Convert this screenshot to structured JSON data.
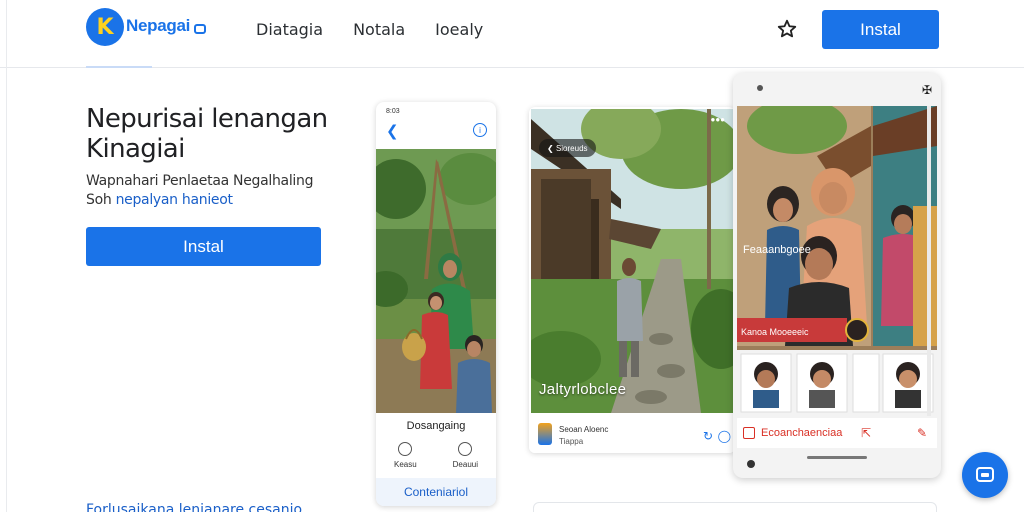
{
  "header": {
    "logo_letter": "K",
    "logo_name": "Nepagai",
    "nav": [
      "Diatagia",
      "Notala",
      "Ioealy"
    ],
    "install_label": "Instal"
  },
  "hero": {
    "title": "Nepurisai lenangan Kinagiai",
    "desc_line1": "Wapnahari Penlaetaa Negalhaling",
    "desc_line2_a": "Soh ",
    "desc_line2_link": "nepalyan hanieot",
    "install_label": "Instal",
    "bottom_link": "Forlusaikana lenianare cesanio"
  },
  "phone1": {
    "status": "8:03",
    "caption": "Dosangaing",
    "icon1_label": "Keasu",
    "icon2_label": "Deauui",
    "footer_label": "Conteniariol"
  },
  "phone2": {
    "pill_label": "Sioreuds",
    "overlay_text": "Jaltyrlobclee",
    "app_name": "Seoan Aloenc",
    "app_sub": "Tiappa"
  },
  "phone3": {
    "top_label": "Feaaanbgoee",
    "lower_label": "Kanoa Mooeeeic",
    "card_label": "Ecoanchaenciaa"
  },
  "colors": {
    "primary": "#1a73e8",
    "link": "#1a5fc8",
    "danger": "#d93025"
  }
}
